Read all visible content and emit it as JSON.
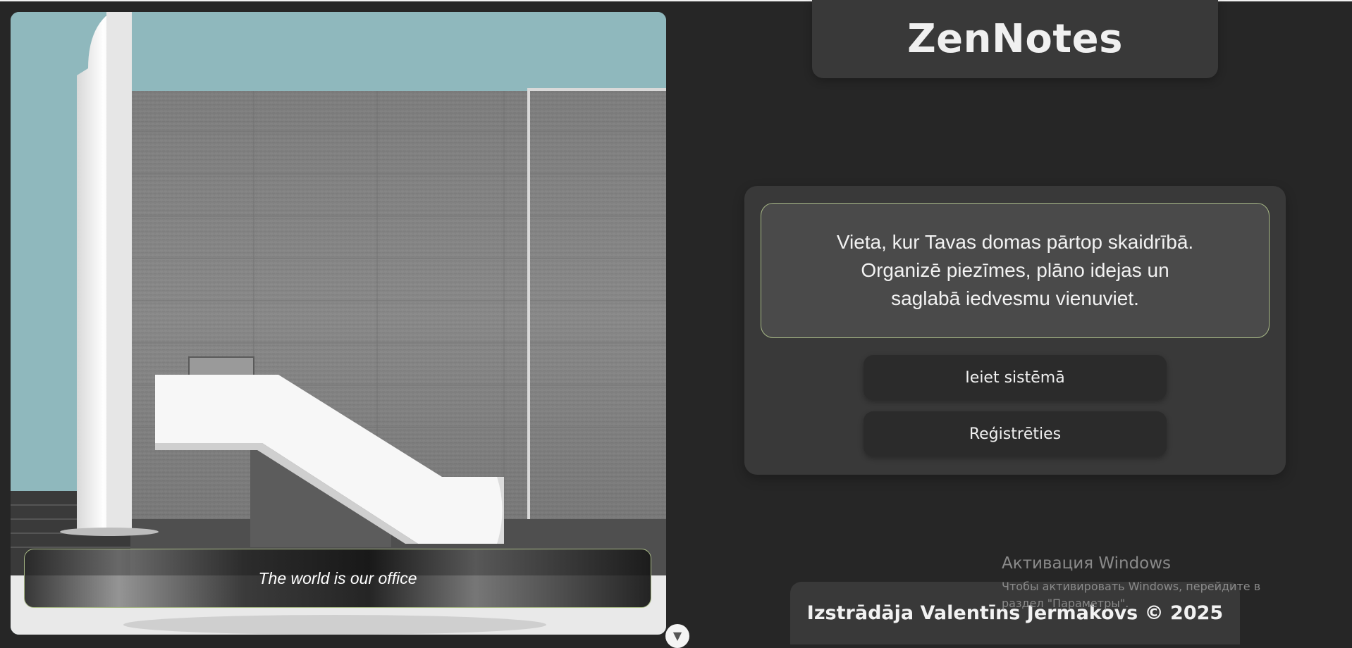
{
  "brand": {
    "title": "ZenNotes"
  },
  "hero": {
    "image_alt": "Modern concrete building with white staircase",
    "caption": "The world is our office"
  },
  "main": {
    "tagline": "Vieta, kur Tavas domas pārtop skaidrībā. Organizē piezīmes, plāno idejas un saglabā iedvesmu vienuviet.",
    "login_label": "Ieiet sistēmā",
    "register_label": "Reģistrēties"
  },
  "footer": {
    "text": "Izstrādāja Valentīns Jermakovs © 2025"
  },
  "watermark": {
    "title": "Активация Windows",
    "subtitle": "Чтобы активировать Windows, перейдите в раздел \"Параметры\"."
  },
  "icons": {
    "scroll_down": "chevron-down-icon"
  },
  "colors": {
    "background": "#262626",
    "card": "#393939",
    "accent_border": "#a7b886",
    "sky": "#8fb8bd"
  }
}
